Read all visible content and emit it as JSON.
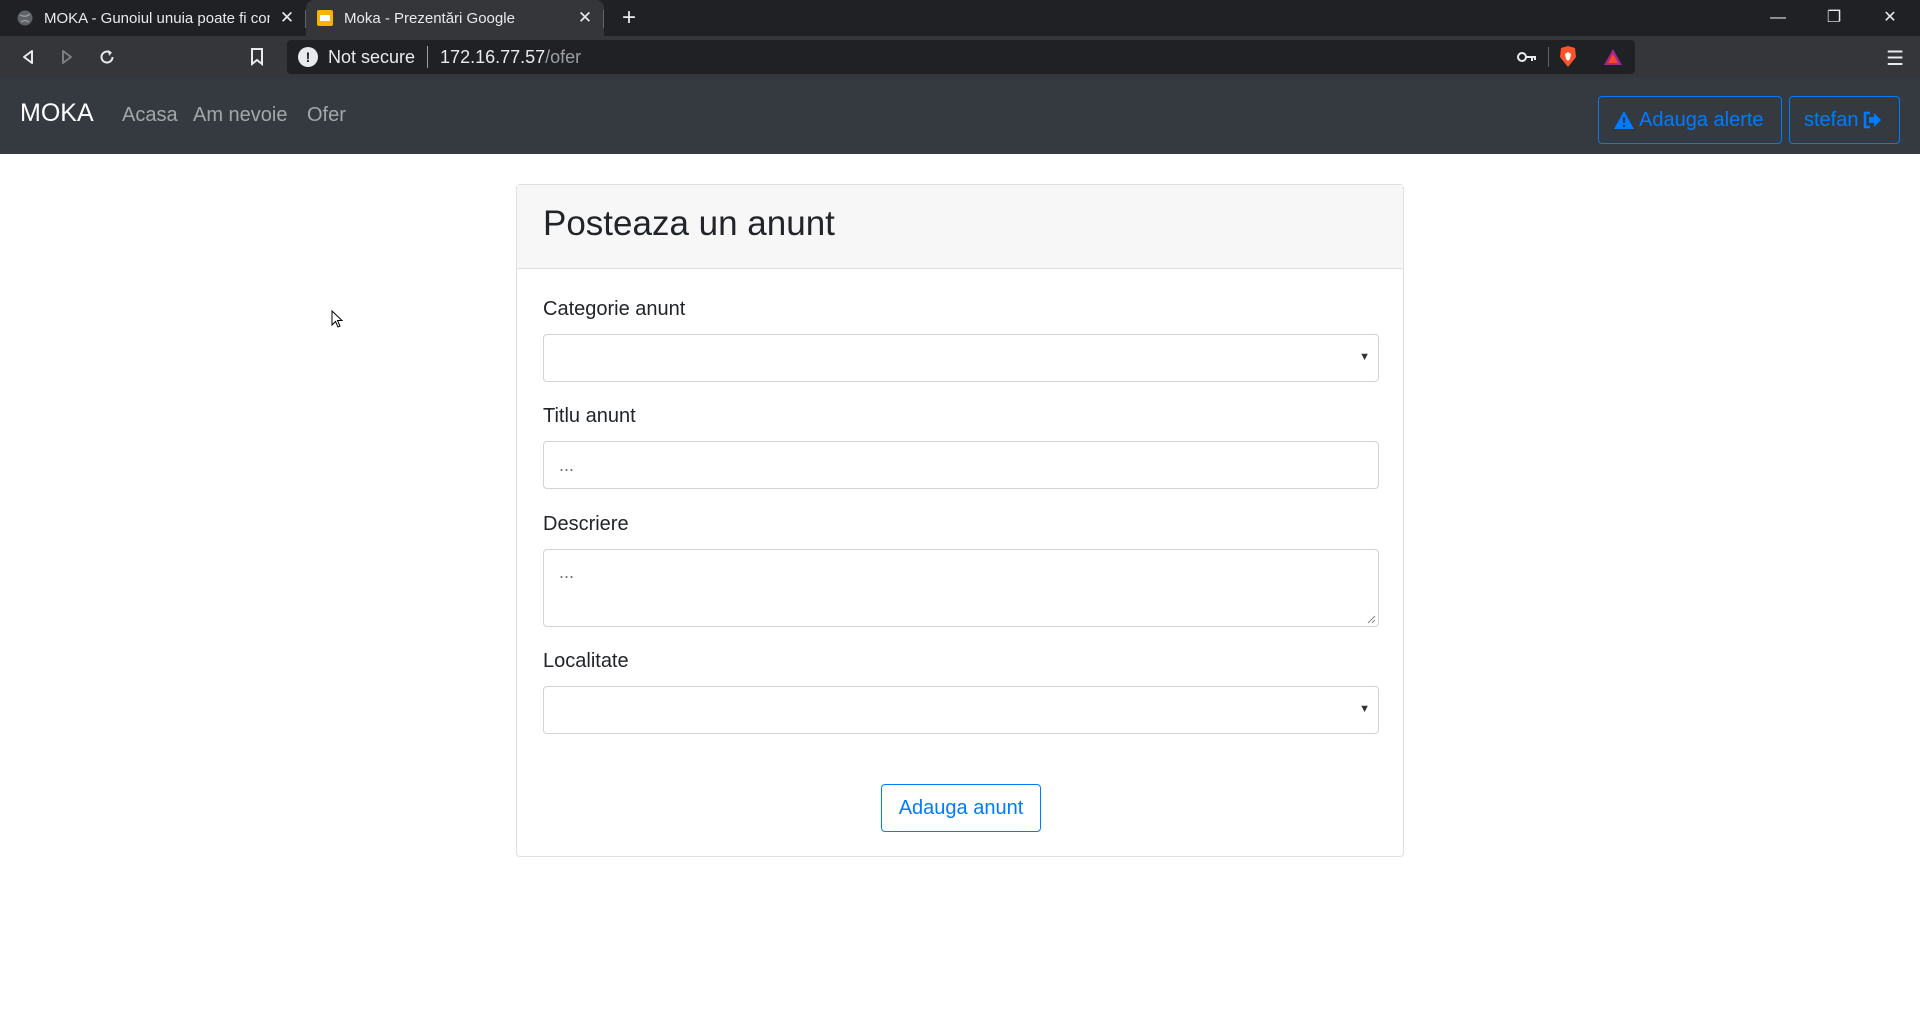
{
  "browser": {
    "tabs": [
      {
        "title": "MOKA - Gunoiul unuia poate fi comoara altuia"
      },
      {
        "title": "Moka - Prezentări Google"
      }
    ],
    "new_tab": "+",
    "address": {
      "security_label": "Not secure",
      "host": "172.16.77.57",
      "path": "/ofer"
    }
  },
  "navbar": {
    "brand": "MOKA",
    "links": [
      "Acasa",
      "Am nevoie",
      "Ofer"
    ],
    "alert_button": "Adauga alerte",
    "user_button": "stefan"
  },
  "form": {
    "title": "Posteaza un anunt",
    "category_label": "Categorie anunt",
    "category_value": "",
    "title_label": "Titlu anunt",
    "title_placeholder": "...",
    "description_label": "Descriere",
    "description_placeholder": "...",
    "locality_label": "Localitate",
    "locality_value": "",
    "submit_label": "Adauga anunt"
  },
  "colors": {
    "primary": "#007bff",
    "navbar_bg": "#343a40",
    "chrome_bg": "#202124"
  }
}
